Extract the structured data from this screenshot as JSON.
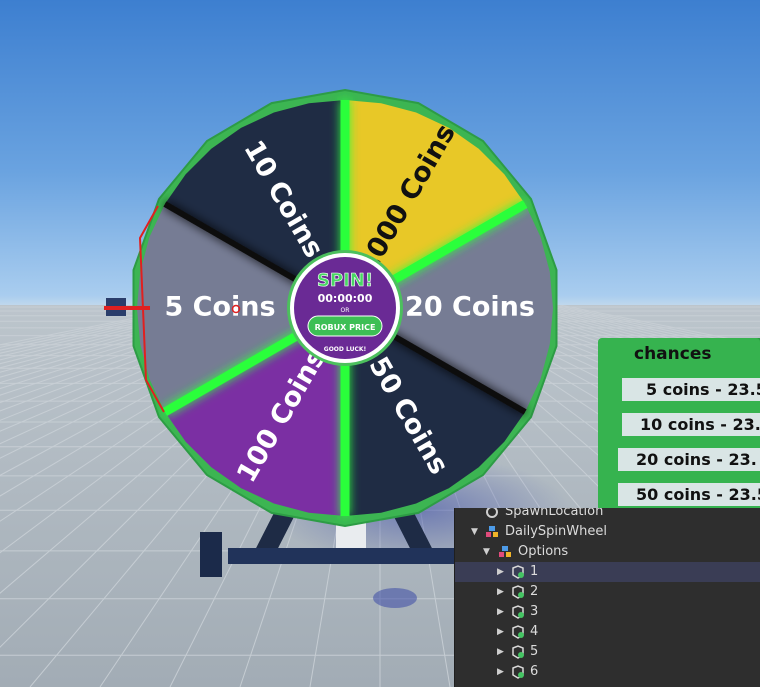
{
  "wheel": {
    "segments": [
      {
        "label": "1000 Coins",
        "color": "#e8c827",
        "text_color": "#111111"
      },
      {
        "label": "20 Coins",
        "color": "#767c94",
        "text_color": "#ffffff"
      },
      {
        "label": "50 Coins",
        "color": "#1f2c44",
        "text_color": "#ffffff"
      },
      {
        "label": "100 Coins",
        "color": "#7b2fa3",
        "text_color": "#ffffff"
      },
      {
        "label": "5 Coins",
        "color": "#767c94",
        "text_color": "#ffffff"
      },
      {
        "label": "10 Coins",
        "color": "#1f2c44",
        "text_color": "#ffffff"
      }
    ],
    "rim_color": "#3cb552",
    "divider_color": "#2aff3a",
    "center": {
      "spin_label": "SPIN!",
      "timer": "00:00:00",
      "or_label": "OR",
      "robux_button": "ROBUX PRICE",
      "good_luck": "GOOD LUCK!",
      "bg_color": "#6a2a95",
      "accent": "#42c85a"
    }
  },
  "chances": {
    "title": "chances",
    "rows": [
      "5 coins - 23.5",
      "10 coins - 23.",
      "20 coins - 23.",
      "50 coins - 23.5"
    ]
  },
  "explorer": {
    "items": [
      {
        "label": "SpawnLocation",
        "icon": "spawn-icon"
      },
      {
        "label": "DailySpinWheel",
        "icon": "model-icon"
      },
      {
        "label": "Options",
        "icon": "folder-icon"
      },
      {
        "label": "1",
        "icon": "part-icon"
      },
      {
        "label": "2",
        "icon": "part-icon"
      },
      {
        "label": "3",
        "icon": "part-icon"
      },
      {
        "label": "4",
        "icon": "part-icon"
      },
      {
        "label": "5",
        "icon": "part-icon"
      },
      {
        "label": "6",
        "icon": "part-icon"
      }
    ]
  }
}
